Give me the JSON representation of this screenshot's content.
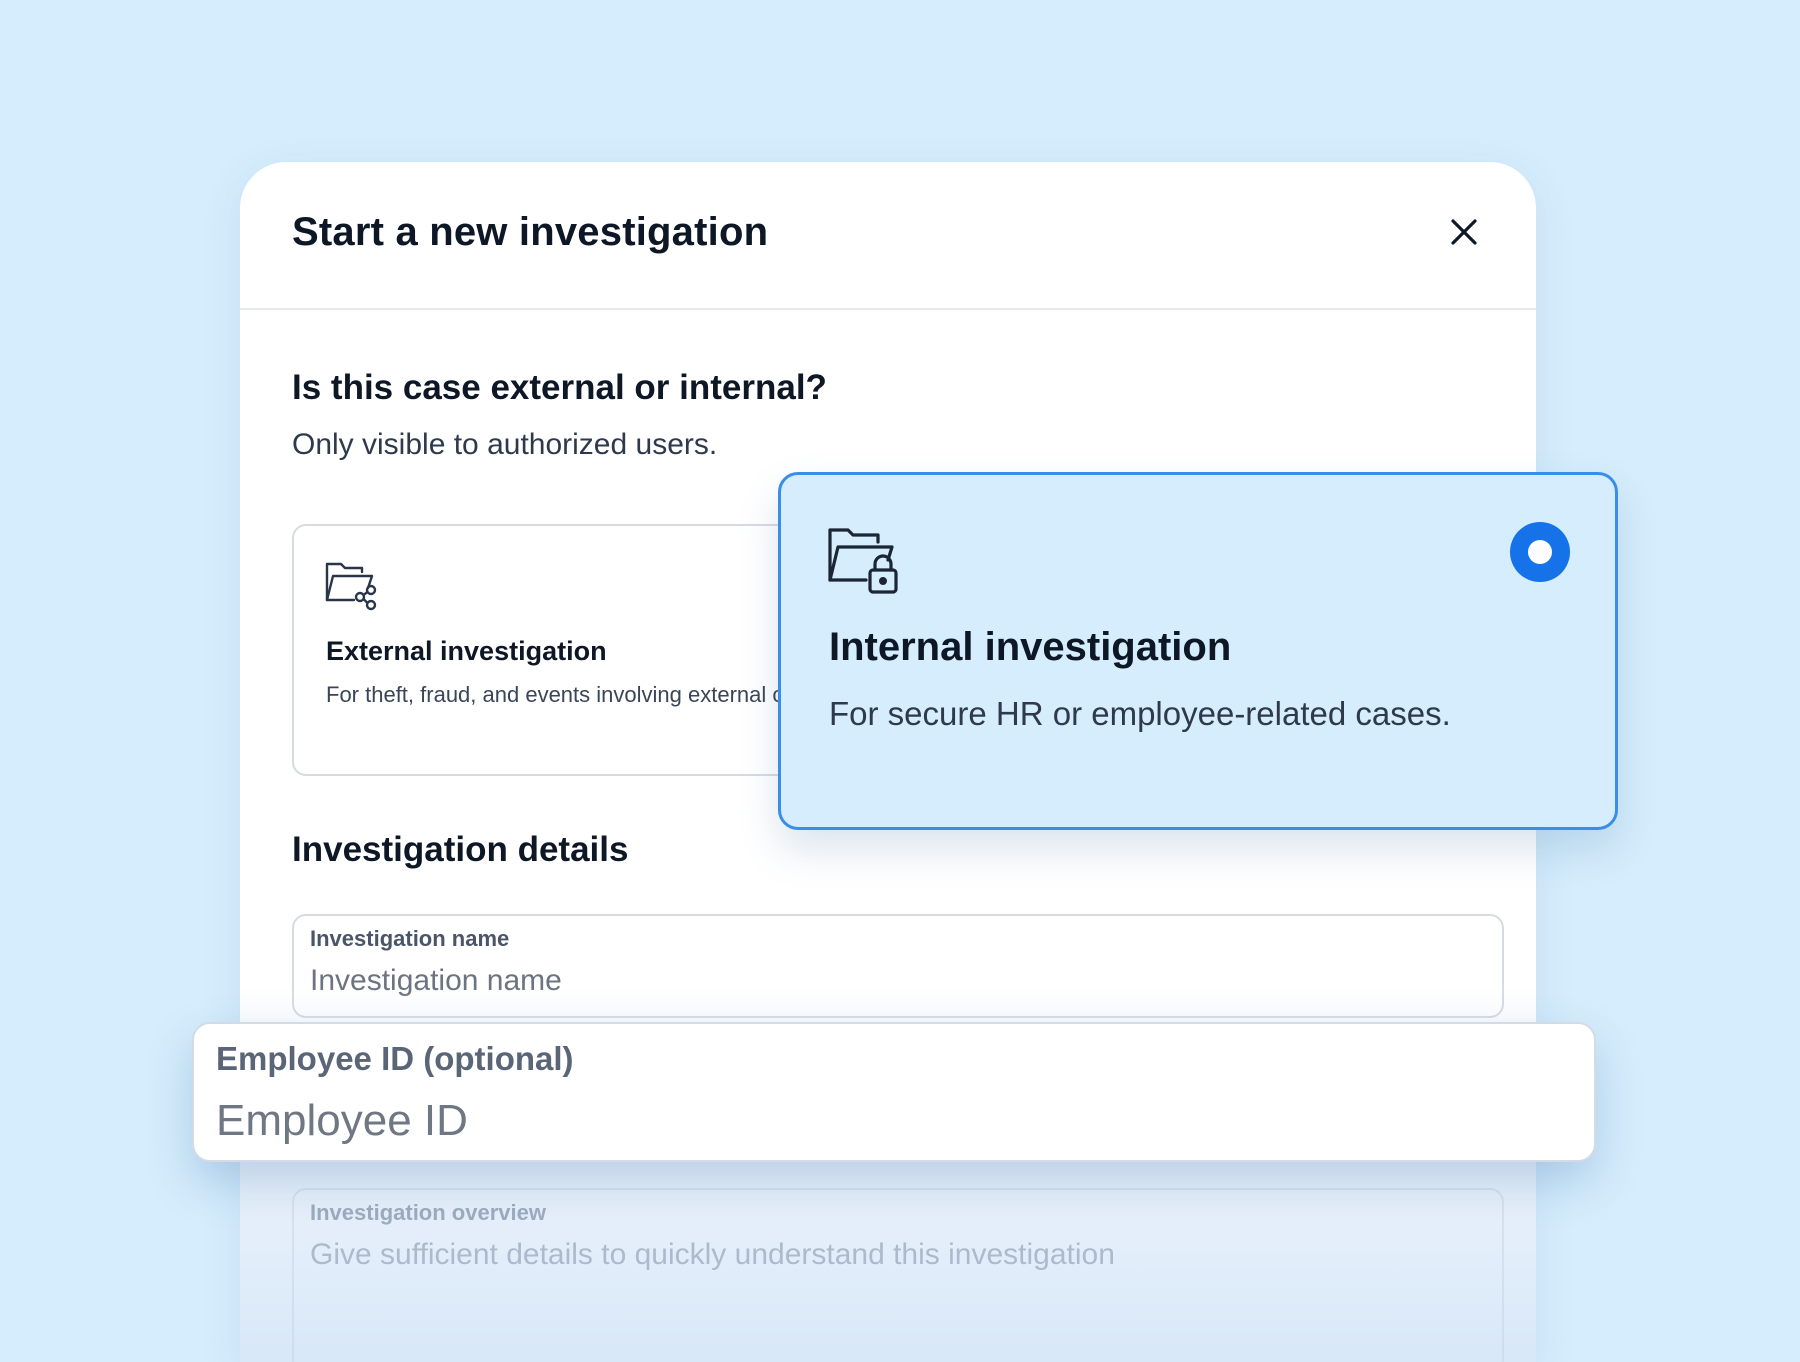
{
  "modal": {
    "title": "Start a new investigation"
  },
  "case_type": {
    "title": "Is this case external or internal?",
    "subtitle": "Only visible to authorized users.",
    "options": [
      {
        "id": "external",
        "title": "External investigation",
        "description": "For theft, fraud, and events involving external offenders.",
        "icon": "folder-share-icon",
        "selected": false
      },
      {
        "id": "internal",
        "title": "Internal investigation",
        "description": "For secure HR or employee-related cases.",
        "icon": "folder-lock-icon",
        "selected": true
      }
    ]
  },
  "details": {
    "title": "Investigation details",
    "fields": {
      "name": {
        "label": "Investigation name",
        "placeholder": "Investigation name"
      },
      "employee_id": {
        "label": "Employee ID (optional)",
        "placeholder": "Employee ID"
      },
      "overview": {
        "label": "Investigation overview",
        "placeholder": "Give sufficient details to quickly understand this investigation"
      }
    }
  },
  "colors": {
    "background": "#d5edfc",
    "accent": "#1672e8",
    "selected_border": "#3a8ee6",
    "selected_card_bg": "#d5edfc",
    "text_primary": "#0d1726"
  }
}
